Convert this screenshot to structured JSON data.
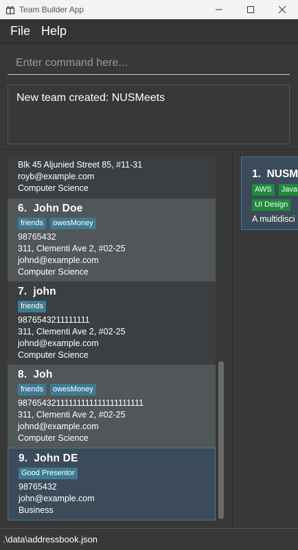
{
  "window": {
    "title": "Team Builder App"
  },
  "menu": {
    "file": "File",
    "help": "Help"
  },
  "command": {
    "placeholder": "Enter command here...",
    "value": ""
  },
  "result": {
    "message": "New team created: NUSMeets"
  },
  "persons": [
    {
      "partial": true,
      "lines": [
        "Blk 45 Aljunied Street 85, #11-31",
        "royb@example.com",
        "Computer Science"
      ]
    },
    {
      "index": "6.",
      "name": "John Doe",
      "tags": [
        "friends",
        "owesMoney"
      ],
      "phone": "98765432",
      "address": "311, Clementi Ave 2, #02-25",
      "email": "johnd@example.com",
      "major": "Computer Science"
    },
    {
      "index": "7.",
      "name": "john",
      "tags": [
        "friends"
      ],
      "phone": "9876543211111111",
      "address": "311, Clementi Ave 2, #02-25",
      "email": "johnd@example.com",
      "major": "Computer Science"
    },
    {
      "index": "8.",
      "name": "Joh",
      "tags": [
        "friends",
        "owesMoney"
      ],
      "phone": "98765432111111111111111111111",
      "address": "311, Clementi Ave 2, #02-25",
      "email": "johnd@example.com",
      "major": "Computer Science"
    },
    {
      "index": "9.",
      "name": "John DE",
      "tags": [
        "Good Presentor"
      ],
      "phone": "98765432",
      "email": "john@example.com",
      "major": "Business"
    }
  ],
  "teams": [
    {
      "index": "1.",
      "name": "NUSM",
      "tags_row1": [
        "AWS",
        "JavaS"
      ],
      "tags_row2": [
        "UI Design"
      ],
      "desc": "A multidisci"
    }
  ],
  "status": {
    "path": ".\\data\\addressbook.json"
  },
  "colors": {
    "tag": "#3e7b91",
    "team_tag": "#1f8a3c",
    "selected_card": "#3c4b5a"
  }
}
